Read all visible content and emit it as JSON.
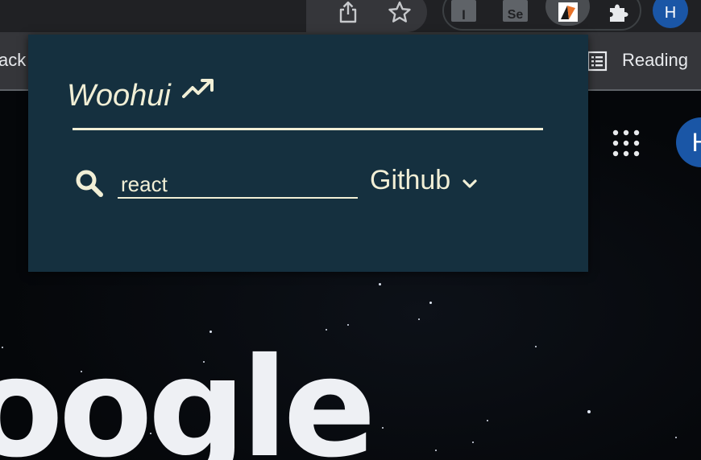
{
  "browser": {
    "bookmarks_left_label": "ack",
    "reading_list_label": "Reading",
    "profile_initial": "H",
    "extension_tiles": [
      "I",
      "Se"
    ],
    "icons": [
      "share-icon",
      "bookmark-star-icon",
      "extension-i-icon",
      "extension-se-icon",
      "extension-active-icon",
      "extensions-puzzle-icon",
      "profile-avatar",
      "reading-list-icon"
    ]
  },
  "page": {
    "logo_fragment": "oogle",
    "profile_initial": "H",
    "icons": [
      "google-apps-icon"
    ]
  },
  "popup": {
    "brand_title": "Woohui",
    "brand_icon": "trending-up-icon",
    "search": {
      "icon": "search-icon",
      "value": "react",
      "placeholder": ""
    },
    "engine": {
      "selected": "Github",
      "icon": "chevron-down-icon"
    }
  },
  "colors": {
    "popup_bg": "#15303f",
    "popup_text": "#f1efd6",
    "toolbar_bg": "#202124",
    "bookmarks_bg": "#35363a",
    "avatar_blue": "#1a56a6"
  }
}
